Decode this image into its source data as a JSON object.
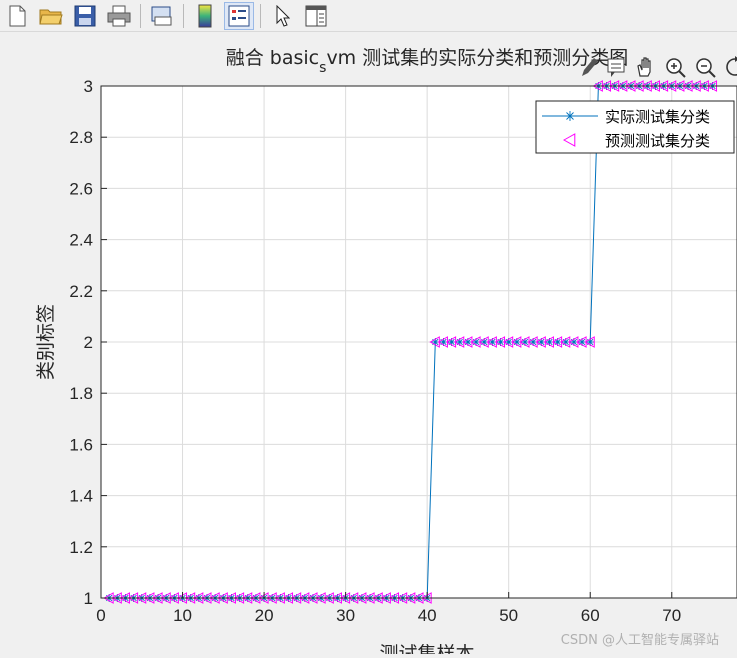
{
  "toolbar": {
    "icons": [
      "new-file-icon",
      "open-folder-icon",
      "save-icon",
      "print-icon",
      "print-preview-icon",
      "colorbar-icon",
      "legend-icon",
      "pointer-icon",
      "property-inspector-icon"
    ]
  },
  "axes_toolbar": {
    "icons": [
      "brush-icon",
      "data-tip-icon",
      "pan-icon",
      "zoom-in-icon",
      "zoom-out-icon",
      "restore-view-icon"
    ]
  },
  "chart_data": {
    "type": "line",
    "title_main": "融合 basic",
    "title_sub": "s",
    "title_rest": "vm 测试集的实际分类和预测分类图",
    "xlabel": "测试集样本",
    "ylabel": "类别标签",
    "xlim": [
      0,
      78
    ],
    "ylim": [
      1,
      3
    ],
    "xticks": [
      0,
      10,
      20,
      30,
      40,
      50,
      60,
      70
    ],
    "yticks": [
      1,
      1.2,
      1.4,
      1.6,
      1.8,
      2,
      2.2,
      2.4,
      2.6,
      2.8,
      3
    ],
    "ytick_labels": [
      "1",
      "1.2",
      "1.4",
      "1.6",
      "1.8",
      "2",
      "2.2",
      "2.4",
      "2.6",
      "2.8",
      "3"
    ],
    "grid": true,
    "legend_position": "top-right",
    "segments": [
      {
        "x_start": 1,
        "x_end": 40,
        "class": 1
      },
      {
        "x_start": 41,
        "x_end": 60,
        "class": 2
      },
      {
        "x_start": 61,
        "x_end": 75,
        "class": 3
      }
    ],
    "series": [
      {
        "name": "实际测试集分类",
        "marker": "asterisk",
        "color": "#0072bd"
      },
      {
        "name": "预测测试集分类",
        "marker": "triangle-left",
        "color": "#ff00ff"
      }
    ]
  },
  "watermark": "CSDN @人工智能专属驿站"
}
